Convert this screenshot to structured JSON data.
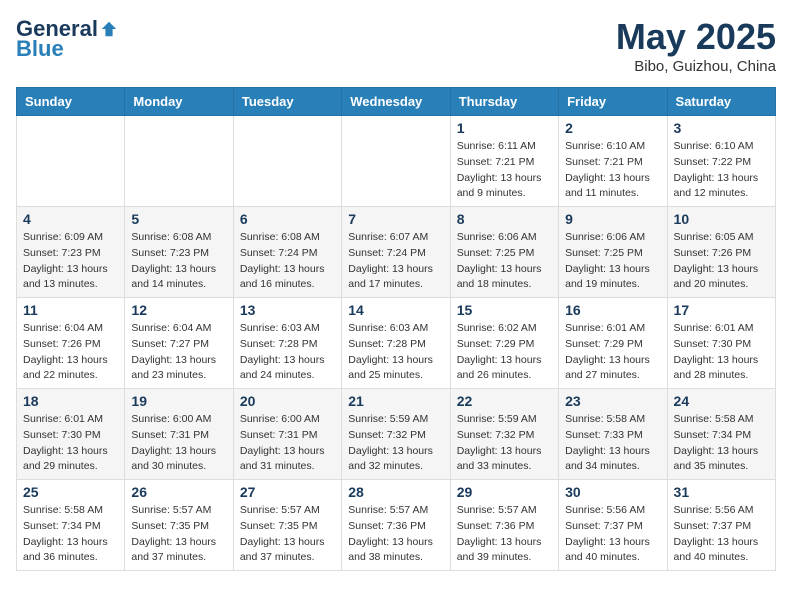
{
  "header": {
    "logo_general": "General",
    "logo_blue": "Blue",
    "month_title": "May 2025",
    "location": "Bibo, Guizhou, China"
  },
  "weekdays": [
    "Sunday",
    "Monday",
    "Tuesday",
    "Wednesday",
    "Thursday",
    "Friday",
    "Saturday"
  ],
  "weeks": [
    [
      {
        "day": "",
        "info": ""
      },
      {
        "day": "",
        "info": ""
      },
      {
        "day": "",
        "info": ""
      },
      {
        "day": "",
        "info": ""
      },
      {
        "day": "1",
        "info": "Sunrise: 6:11 AM\nSunset: 7:21 PM\nDaylight: 13 hours and 9 minutes."
      },
      {
        "day": "2",
        "info": "Sunrise: 6:10 AM\nSunset: 7:21 PM\nDaylight: 13 hours and 11 minutes."
      },
      {
        "day": "3",
        "info": "Sunrise: 6:10 AM\nSunset: 7:22 PM\nDaylight: 13 hours and 12 minutes."
      }
    ],
    [
      {
        "day": "4",
        "info": "Sunrise: 6:09 AM\nSunset: 7:23 PM\nDaylight: 13 hours and 13 minutes."
      },
      {
        "day": "5",
        "info": "Sunrise: 6:08 AM\nSunset: 7:23 PM\nDaylight: 13 hours and 14 minutes."
      },
      {
        "day": "6",
        "info": "Sunrise: 6:08 AM\nSunset: 7:24 PM\nDaylight: 13 hours and 16 minutes."
      },
      {
        "day": "7",
        "info": "Sunrise: 6:07 AM\nSunset: 7:24 PM\nDaylight: 13 hours and 17 minutes."
      },
      {
        "day": "8",
        "info": "Sunrise: 6:06 AM\nSunset: 7:25 PM\nDaylight: 13 hours and 18 minutes."
      },
      {
        "day": "9",
        "info": "Sunrise: 6:06 AM\nSunset: 7:25 PM\nDaylight: 13 hours and 19 minutes."
      },
      {
        "day": "10",
        "info": "Sunrise: 6:05 AM\nSunset: 7:26 PM\nDaylight: 13 hours and 20 minutes."
      }
    ],
    [
      {
        "day": "11",
        "info": "Sunrise: 6:04 AM\nSunset: 7:26 PM\nDaylight: 13 hours and 22 minutes."
      },
      {
        "day": "12",
        "info": "Sunrise: 6:04 AM\nSunset: 7:27 PM\nDaylight: 13 hours and 23 minutes."
      },
      {
        "day": "13",
        "info": "Sunrise: 6:03 AM\nSunset: 7:28 PM\nDaylight: 13 hours and 24 minutes."
      },
      {
        "day": "14",
        "info": "Sunrise: 6:03 AM\nSunset: 7:28 PM\nDaylight: 13 hours and 25 minutes."
      },
      {
        "day": "15",
        "info": "Sunrise: 6:02 AM\nSunset: 7:29 PM\nDaylight: 13 hours and 26 minutes."
      },
      {
        "day": "16",
        "info": "Sunrise: 6:01 AM\nSunset: 7:29 PM\nDaylight: 13 hours and 27 minutes."
      },
      {
        "day": "17",
        "info": "Sunrise: 6:01 AM\nSunset: 7:30 PM\nDaylight: 13 hours and 28 minutes."
      }
    ],
    [
      {
        "day": "18",
        "info": "Sunrise: 6:01 AM\nSunset: 7:30 PM\nDaylight: 13 hours and 29 minutes."
      },
      {
        "day": "19",
        "info": "Sunrise: 6:00 AM\nSunset: 7:31 PM\nDaylight: 13 hours and 30 minutes."
      },
      {
        "day": "20",
        "info": "Sunrise: 6:00 AM\nSunset: 7:31 PM\nDaylight: 13 hours and 31 minutes."
      },
      {
        "day": "21",
        "info": "Sunrise: 5:59 AM\nSunset: 7:32 PM\nDaylight: 13 hours and 32 minutes."
      },
      {
        "day": "22",
        "info": "Sunrise: 5:59 AM\nSunset: 7:32 PM\nDaylight: 13 hours and 33 minutes."
      },
      {
        "day": "23",
        "info": "Sunrise: 5:58 AM\nSunset: 7:33 PM\nDaylight: 13 hours and 34 minutes."
      },
      {
        "day": "24",
        "info": "Sunrise: 5:58 AM\nSunset: 7:34 PM\nDaylight: 13 hours and 35 minutes."
      }
    ],
    [
      {
        "day": "25",
        "info": "Sunrise: 5:58 AM\nSunset: 7:34 PM\nDaylight: 13 hours and 36 minutes."
      },
      {
        "day": "26",
        "info": "Sunrise: 5:57 AM\nSunset: 7:35 PM\nDaylight: 13 hours and 37 minutes."
      },
      {
        "day": "27",
        "info": "Sunrise: 5:57 AM\nSunset: 7:35 PM\nDaylight: 13 hours and 37 minutes."
      },
      {
        "day": "28",
        "info": "Sunrise: 5:57 AM\nSunset: 7:36 PM\nDaylight: 13 hours and 38 minutes."
      },
      {
        "day": "29",
        "info": "Sunrise: 5:57 AM\nSunset: 7:36 PM\nDaylight: 13 hours and 39 minutes."
      },
      {
        "day": "30",
        "info": "Sunrise: 5:56 AM\nSunset: 7:37 PM\nDaylight: 13 hours and 40 minutes."
      },
      {
        "day": "31",
        "info": "Sunrise: 5:56 AM\nSunset: 7:37 PM\nDaylight: 13 hours and 40 minutes."
      }
    ]
  ]
}
